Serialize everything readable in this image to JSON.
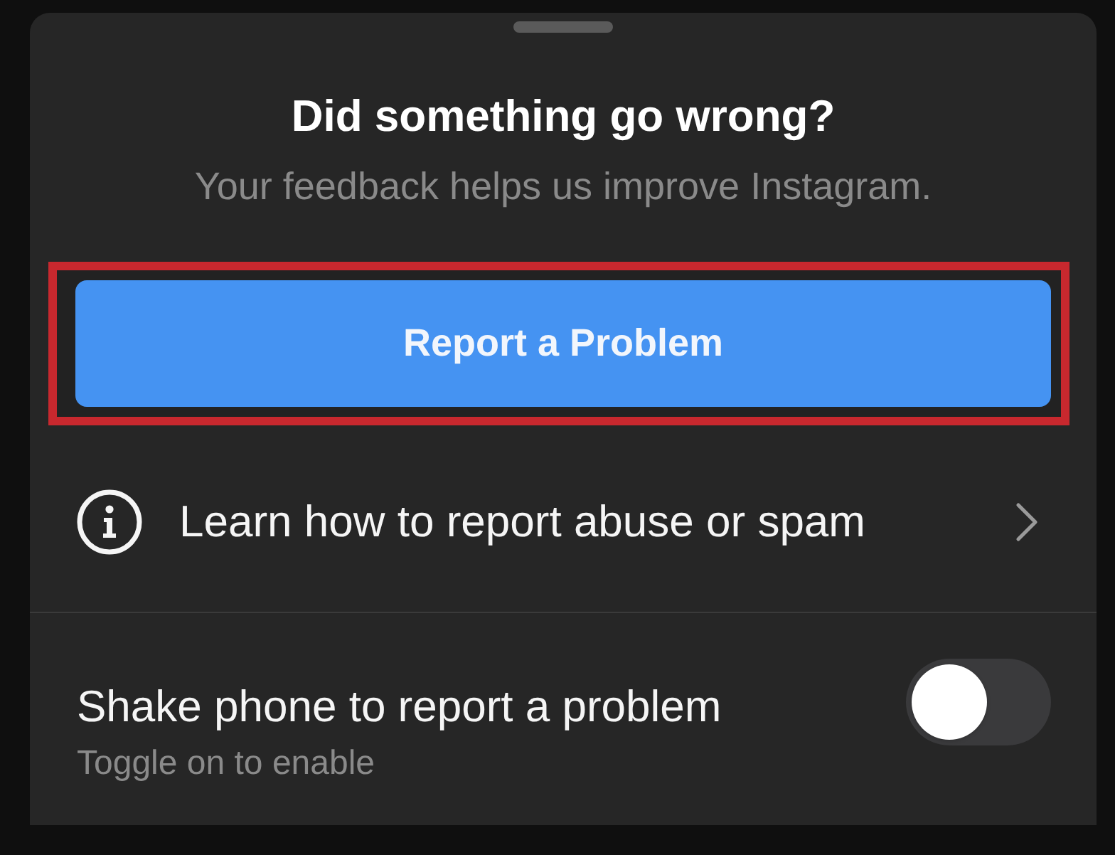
{
  "sheet": {
    "title": "Did something go wrong?",
    "subtitle": "Your feedback helps us improve Instagram."
  },
  "report_button": {
    "label": "Report a Problem",
    "highlighted": true
  },
  "rows": [
    {
      "kind": "link",
      "label": "Learn how to report abuse or spam"
    },
    {
      "kind": "toggle",
      "label": "Shake phone to report a problem",
      "hint": "Toggle on to enable",
      "on": false
    }
  ]
}
